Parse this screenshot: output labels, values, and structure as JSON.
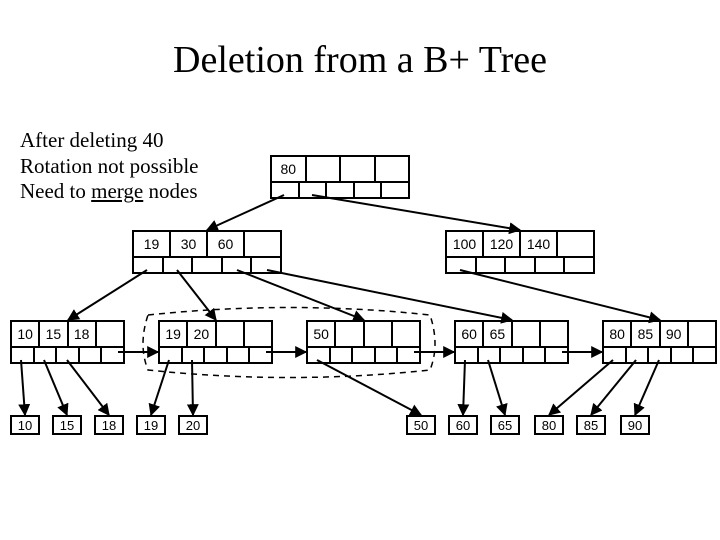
{
  "title": "Deletion from a B+ Tree",
  "note": {
    "line1": "After deleting 40",
    "line2": "Rotation not possible",
    "line3a": "Need to ",
    "line3b": "merge",
    "line3c": " nodes"
  },
  "root": {
    "keys": [
      "80",
      "",
      "",
      ""
    ]
  },
  "internal": {
    "left": {
      "keys": [
        "19",
        "30",
        "60",
        ""
      ]
    },
    "right": {
      "keys": [
        "100",
        "120",
        "140",
        ""
      ]
    }
  },
  "leaves": {
    "l0": [
      "10",
      "15",
      "18",
      ""
    ],
    "l1": [
      "19",
      "20",
      "",
      ""
    ],
    "l2": [
      "50",
      "",
      "",
      ""
    ],
    "l3": [
      "60",
      "65",
      "",
      ""
    ],
    "l4": [
      "80",
      "85",
      "90",
      ""
    ]
  },
  "data": {
    "l0": [
      "10",
      "15",
      "18"
    ],
    "l1": [
      "19",
      "20"
    ],
    "l2": [
      "50"
    ],
    "l3": [
      "60",
      "65"
    ],
    "l4": [
      "80",
      "85",
      "90"
    ]
  }
}
